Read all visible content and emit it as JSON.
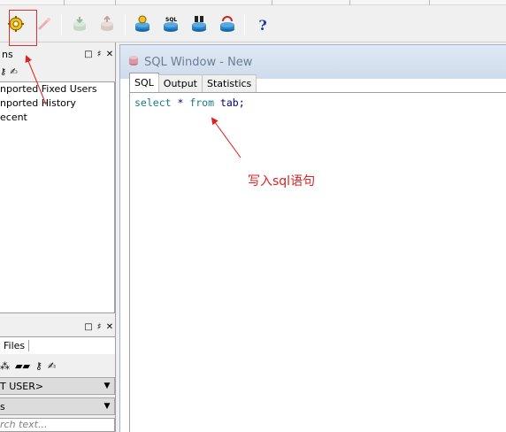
{
  "sql_window": {
    "title": "SQL Window - New",
    "tabs": [
      {
        "label": "SQL",
        "active": true
      },
      {
        "label": "Output",
        "active": false
      },
      {
        "label": "Statistics",
        "active": false
      }
    ],
    "code": {
      "kw1": "select",
      "rest1": " * ",
      "kw2": "from",
      "rest2": " tab;"
    }
  },
  "objects_panel": {
    "title": "ns",
    "items": [
      "nported Fixed Users",
      "nported History",
      "ecent"
    ]
  },
  "files_panel": {
    "tab_label": "Files",
    "user_select": "T USER>",
    "second_select": "s",
    "search_placeholder": "rch text..."
  },
  "annotation": {
    "text": "写入sql语句",
    "color": "#e02020"
  },
  "toolbar": {
    "icons": [
      "gear-icon",
      "wand-icon",
      "database-down-icon",
      "database-up-icon",
      "database-user-icon",
      "sql-database-icon",
      "binoculars-database-icon",
      "database-refresh-icon",
      "help-icon"
    ]
  }
}
